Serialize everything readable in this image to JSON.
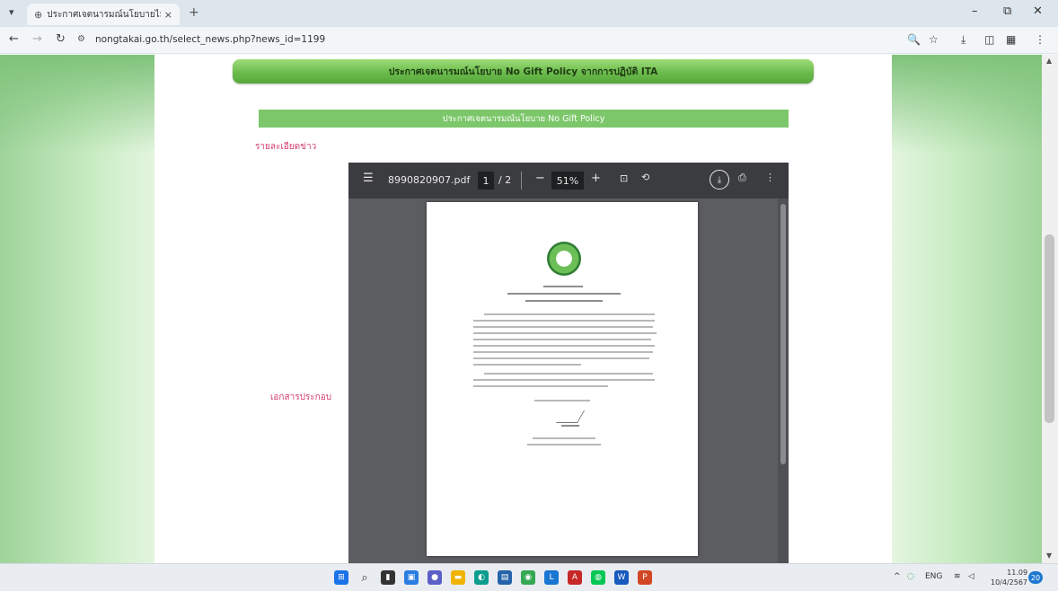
{
  "browser": {
    "tab_menu_icon": "chevron-down-icon",
    "tab_title": "ประกาศเจตนารมณ์นโยบายไม่",
    "tab_close": "×",
    "new_tab": "+",
    "url": "nongtakai.go.th/select_news.php?news_id=1199",
    "window_controls": {
      "minimize": "–",
      "restore": "⧉",
      "close": "✕"
    }
  },
  "page": {
    "banner_title": "ประกาศเจตนารมณ์นโยบาย No Gift Policy จากการปฏิบัติ ITA",
    "sub_header": "ประกาศเจตนารมณ์นโยบาย No Gift Policy",
    "detail_label": "รายละเอียดข่าว",
    "attachment_label": "เอกสารประกอบ"
  },
  "pdf": {
    "filename": "8990820907.pdf",
    "current_page": "1",
    "total_pages": "/ 2",
    "zoom": "51%"
  },
  "taskbar": {
    "language": "ENG",
    "time": "11.09",
    "date": "10/4/2567",
    "notification_count": "20"
  },
  "colors": {
    "accent_green": "#6bbb4c",
    "label_pink": "#d23c6a",
    "pdf_toolbar": "#3b3c3f"
  }
}
